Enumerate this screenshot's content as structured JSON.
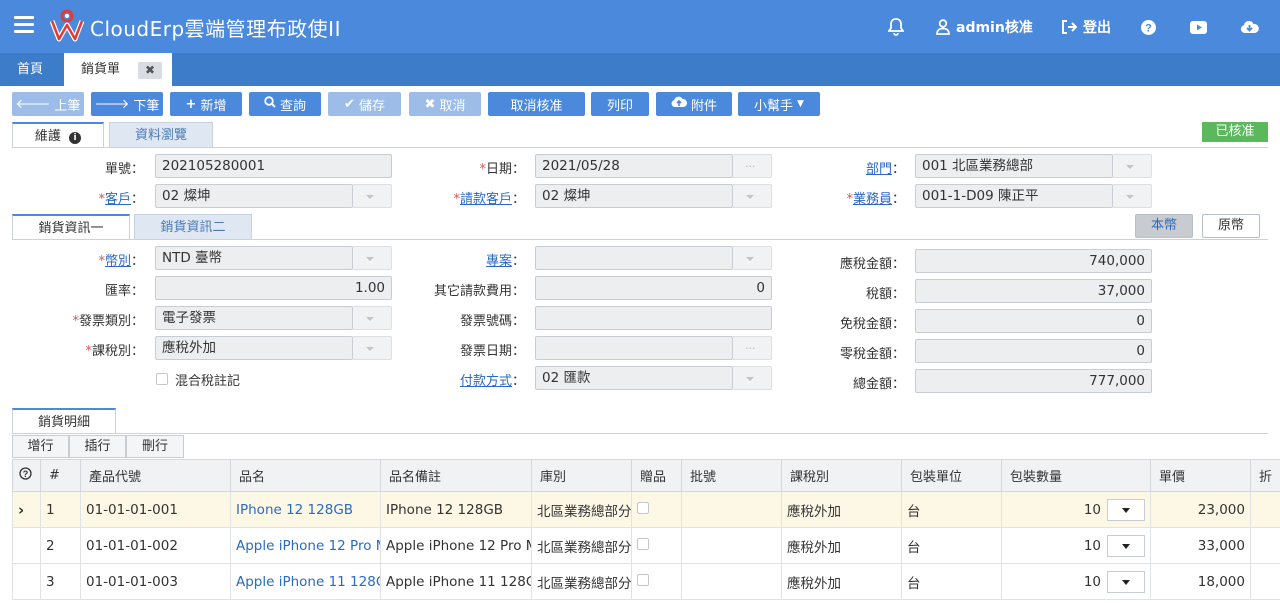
{
  "app": {
    "title": "CloudErp雲端管理布政使II",
    "user": "admin核准",
    "logout": "登出"
  },
  "tabs": [
    {
      "label": "首頁"
    },
    {
      "label": "銷貨單"
    }
  ],
  "toolbar": {
    "prev": "上筆",
    "next": "下筆",
    "add": "新增",
    "query": "查詢",
    "save": "儲存",
    "cancel": "取消",
    "unapprove": "取消核准",
    "print": "列印",
    "attach": "附件",
    "helper": "小幫手"
  },
  "form_tabs": {
    "maintain": "維護",
    "browse": "資料瀏覽"
  },
  "status_badge": "已核准",
  "header": {
    "order_no": {
      "label": "單號",
      "value": "202105280001"
    },
    "date": {
      "label": "日期",
      "value": "2021/05/28"
    },
    "department": {
      "label": "部門",
      "value": "001 北區業務總部"
    },
    "customer": {
      "label": "客戶",
      "value": "02 燦坤"
    },
    "bill_customer": {
      "label": "請款客戶",
      "value": "02 燦坤"
    },
    "salesman": {
      "label": "業務員",
      "value": "001-1-D09 陳正平"
    }
  },
  "info_tabs": {
    "tab1": "銷貨資訊一",
    "tab2": "銷貨資訊二"
  },
  "currency_toggle": {
    "local": "本幣",
    "original": "原幣"
  },
  "info": {
    "currency": {
      "label": "幣別",
      "value": "NTD 臺幣"
    },
    "rate": {
      "label": "匯率",
      "value": "1.00"
    },
    "invoice_type": {
      "label": "發票類別",
      "value": "電子發票"
    },
    "tax_type": {
      "label": "課稅別",
      "value": "應稅外加"
    },
    "mixed_tax": {
      "label": "混合稅註記"
    },
    "project": {
      "label": "專案",
      "value": ""
    },
    "other_fee": {
      "label": "其它請款費用",
      "value": "0"
    },
    "invoice_no": {
      "label": "發票號碼",
      "value": ""
    },
    "invoice_date": {
      "label": "發票日期",
      "value": ""
    },
    "payment": {
      "label": "付款方式",
      "value": "02 匯款"
    },
    "taxable_amount": {
      "label": "應稅金額",
      "value": "740,000"
    },
    "tax": {
      "label": "稅額",
      "value": "37,000"
    },
    "tax_free_amount": {
      "label": "免稅金額",
      "value": "0"
    },
    "zero_tax_amount": {
      "label": "零稅金額",
      "value": "0"
    },
    "total": {
      "label": "總金額",
      "value": "777,000"
    }
  },
  "detail": {
    "tab": "銷貨明細",
    "add_row": "增行",
    "insert_row": "插行",
    "delete_row": "刪行",
    "columns": [
      "#",
      "產品代號",
      "品名",
      "品名備註",
      "庫別",
      "贈品",
      "批號",
      "課稅別",
      "包裝單位",
      "包裝數量",
      "單價",
      "折"
    ],
    "rows": [
      {
        "no": "1",
        "code": "01-01-01-001",
        "name": "IPhone 12 128GB",
        "note": "IPhone 12 128GB",
        "warehouse": "北區業務總部分",
        "batch": "",
        "tax": "應稅外加",
        "unit": "台",
        "qty": "10",
        "price": "23,000"
      },
      {
        "no": "2",
        "code": "01-01-01-002",
        "name": "Apple iPhone 12 Pro M",
        "note": "Apple iPhone 12 Pro M",
        "warehouse": "北區業務總部分",
        "batch": "",
        "tax": "應稅外加",
        "unit": "台",
        "qty": "10",
        "price": "33,000"
      },
      {
        "no": "3",
        "code": "01-01-01-003",
        "name": "Apple iPhone 11 128G",
        "note": "Apple iPhone 11 128G",
        "warehouse": "北區業務總部分",
        "batch": "",
        "tax": "應稅外加",
        "unit": "台",
        "qty": "10",
        "price": "18,000"
      }
    ]
  },
  "colors": {
    "primary": "#4a89dc",
    "tabbar": "#3d7cc9",
    "approved": "#5cb85c",
    "link": "#2a6ac2"
  }
}
